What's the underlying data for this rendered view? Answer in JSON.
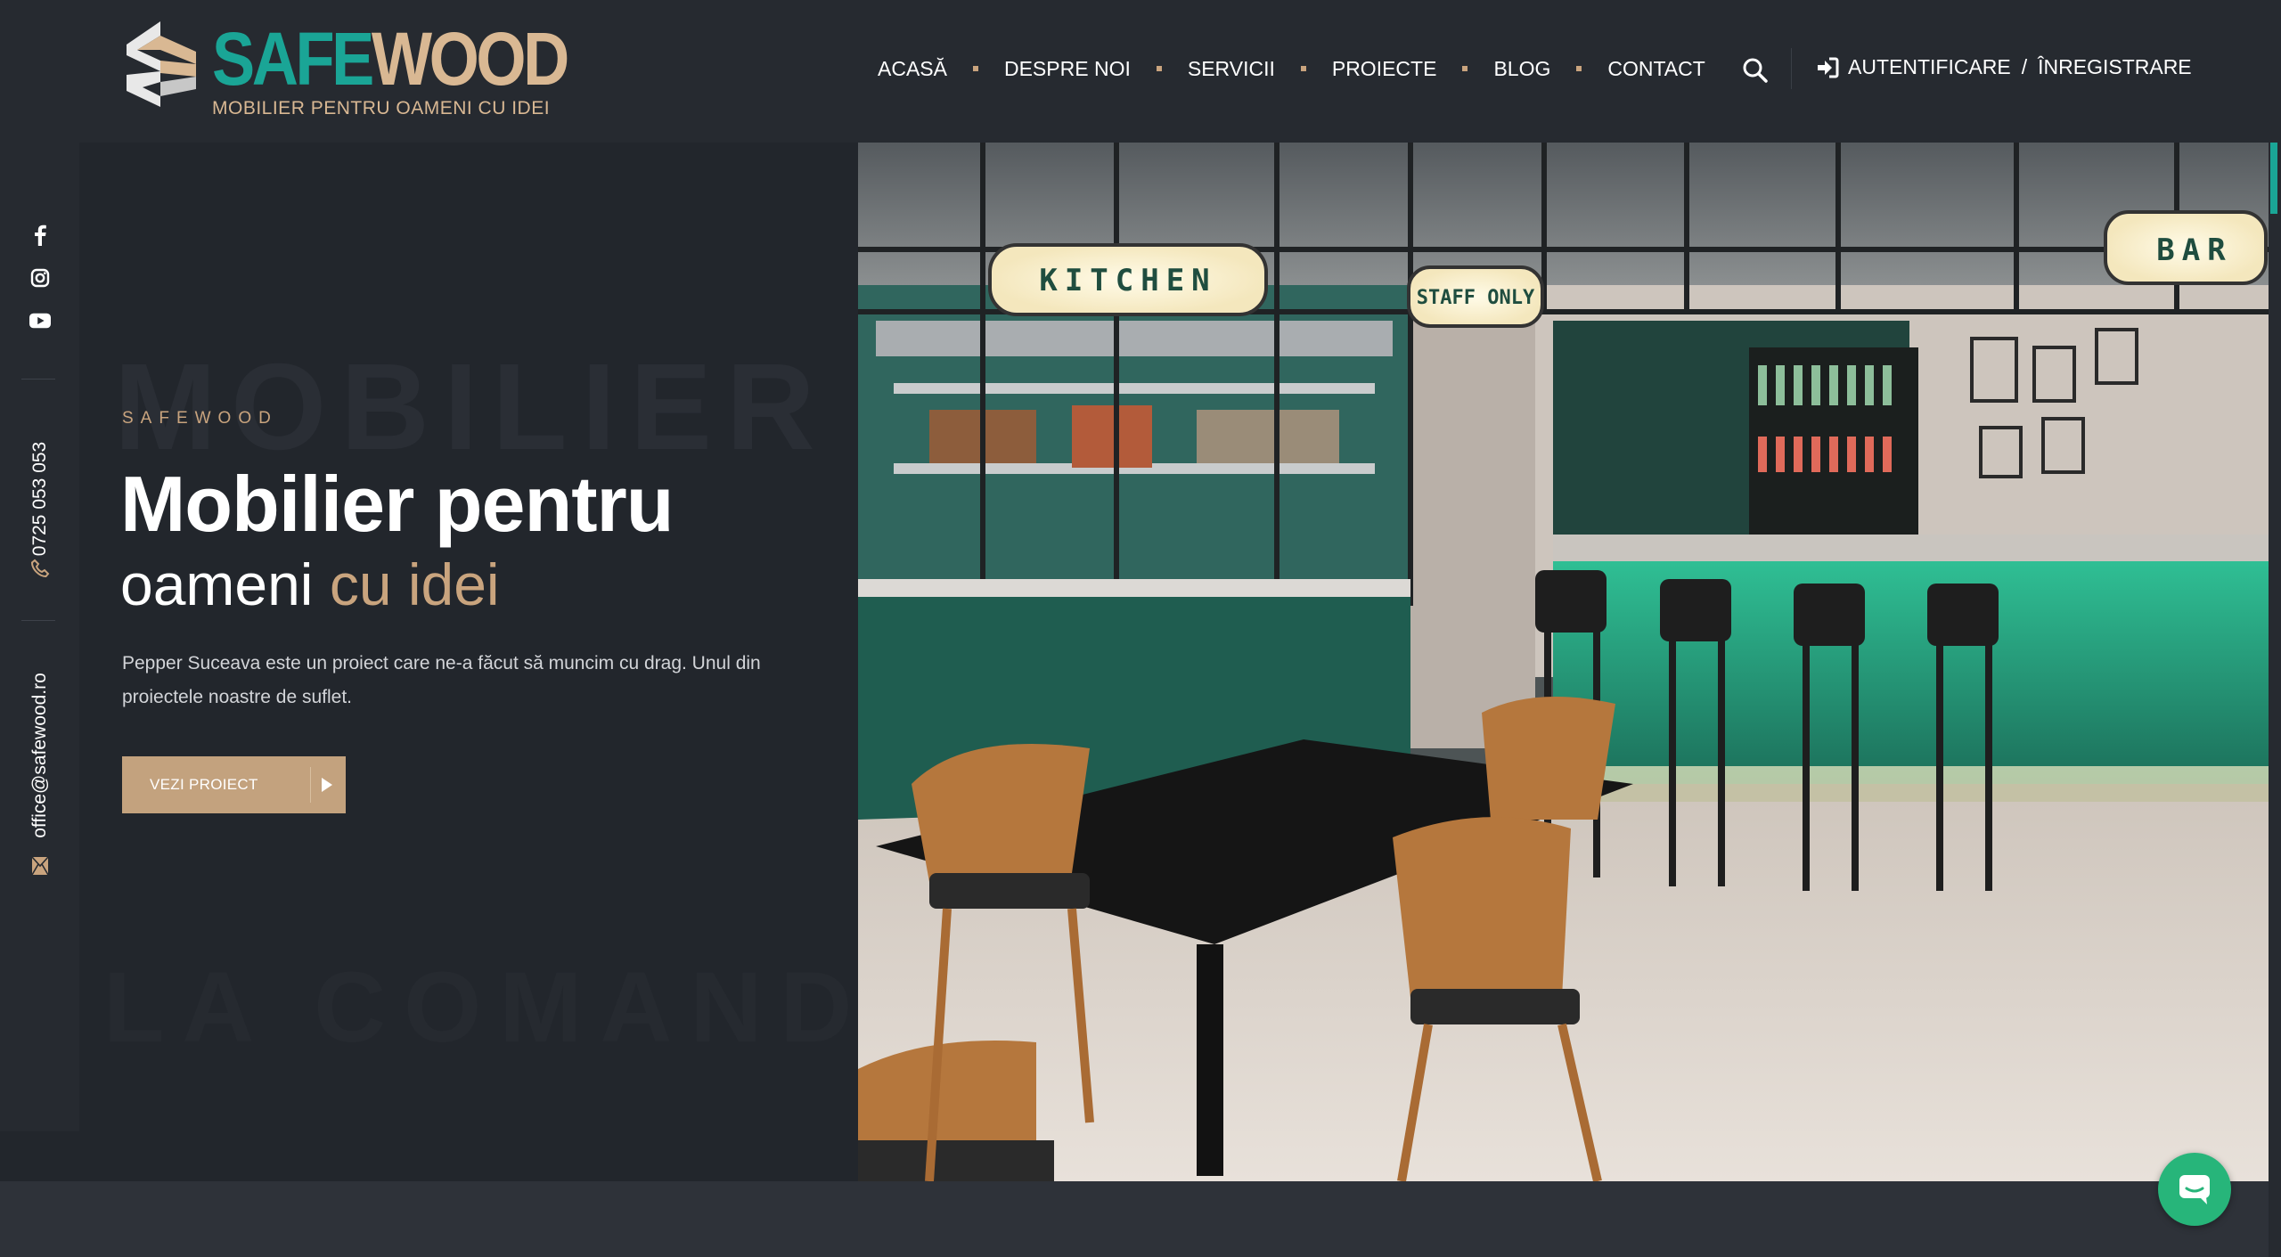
{
  "logo": {
    "word_a": "SAFE",
    "word_b": "WOOD",
    "tagline": "MOBILIER PENTRU OAMENI CU IDEI"
  },
  "nav": {
    "items": [
      "ACASĂ",
      "DESPRE NOI",
      "SERVICII",
      "PROIECTE",
      "BLOG",
      "CONTACT"
    ]
  },
  "auth": {
    "login": "AUTENTIFICARE",
    "separator": "/",
    "register": "ÎNREGISTRARE"
  },
  "icons": {
    "search": "search-icon",
    "login": "sign-in-icon",
    "facebook": "facebook-icon",
    "instagram": "instagram-icon",
    "youtube": "youtube-icon",
    "phone": "phone-icon",
    "email": "envelope-icon",
    "chat": "chat-icon",
    "play": "play-arrow-icon"
  },
  "sidebar": {
    "phone": "0725 053 053",
    "email": "office@safewood.ro"
  },
  "hero": {
    "ghost_top": "MOBILIER",
    "ghost_bottom": "LA COMANDĂ",
    "eyebrow": "SAFEWOOD",
    "title_line1": "Mobilier pentru",
    "title_line2_a": "oameni ",
    "title_line2_b": "cu idei",
    "description": "Pepper Suceava este un proiect care ne-a făcut să muncim cu drag. Unul din proiectele noastre de suflet.",
    "button": "VEZI PROIECT"
  },
  "photo": {
    "sign_kitchen": "KITCHEN",
    "sign_staff": "STAFF ONLY",
    "sign_bar": "BAR"
  },
  "colors": {
    "background": "#22262c",
    "header": "#262a30",
    "teal": "#1aa596",
    "gold": "#c9a47e",
    "button": "#c3a27e",
    "chat": "#27b57a"
  }
}
